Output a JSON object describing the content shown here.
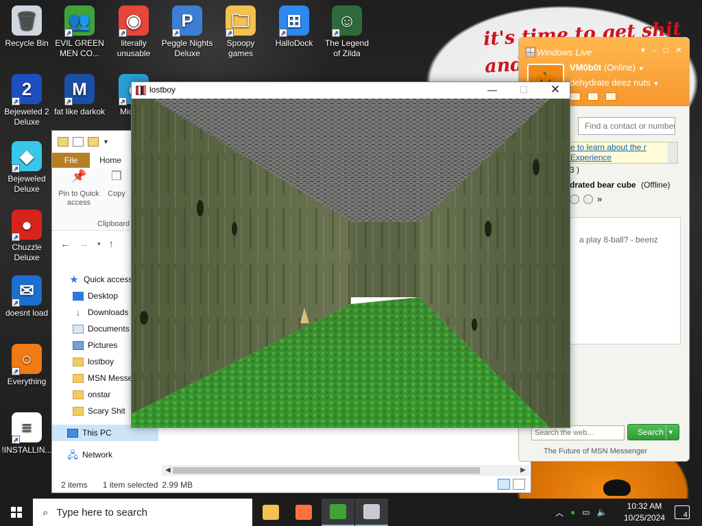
{
  "desktop": {
    "wallpaper_text": "it's time to get shit and",
    "icons": [
      {
        "label": "Recycle Bin",
        "icon": "recycle-bin-icon",
        "color": "#cfd6de"
      },
      {
        "label": "EVIL GREEN MEN CO...",
        "icon": "msn-buddies-icon",
        "color": "#3fa33a"
      },
      {
        "label": "literally unusable",
        "icon": "chrome-icon",
        "color": "#e8453c"
      },
      {
        "label": "Peggle Nights Deluxe",
        "icon": "peggle-icon",
        "color": "#3c7fd8"
      },
      {
        "label": "Spoopy games",
        "icon": "folder-icon",
        "color": "#f2c14e"
      },
      {
        "label": "HalloDock",
        "icon": "windows-logo-icon",
        "color": "#2d89ef"
      },
      {
        "label": "The Legend of Zilda",
        "icon": "zilda-icon",
        "color": "#2f6b3a"
      },
      {
        "label": "Bejeweled 2 Deluxe",
        "icon": "bejeweled-2-icon",
        "color": "#1f4fbf"
      },
      {
        "label": "fat like darkok",
        "icon": "mpl-icon",
        "color": "#1a4fa8"
      },
      {
        "label": "Micr Ec",
        "icon": "edge-icon",
        "color": "#2aa0d8"
      },
      {
        "label": "Bejeweled Deluxe",
        "icon": "diamond-icon",
        "color": "#38c7e8"
      },
      {
        "label": "Chuzzle Deluxe",
        "icon": "chuzzle-icon",
        "color": "#d8231c"
      },
      {
        "label": "doesnt load",
        "icon": "thunderbird-icon",
        "color": "#1b6fd0"
      },
      {
        "label": "Everything",
        "icon": "magnifier-icon",
        "color": "#f07a15"
      },
      {
        "label": "!INSTALLIN...",
        "icon": "text-file-icon",
        "color": "#ffffff"
      }
    ]
  },
  "explorer": {
    "tabs": [
      "File",
      "Home"
    ],
    "ribbon": {
      "pin": "Pin to Quick access",
      "copy": "Copy",
      "group": "Clipboard"
    },
    "tree": [
      {
        "label": "Quick access",
        "icon": "star-icon",
        "kind": "star"
      },
      {
        "label": "Desktop",
        "icon": "desktop-icon",
        "kind": "blue"
      },
      {
        "label": "Downloads",
        "icon": "downloads-icon",
        "kind": "down"
      },
      {
        "label": "Documents",
        "icon": "documents-icon",
        "kind": "doc"
      },
      {
        "label": "Pictures",
        "icon": "pictures-icon",
        "kind": "pic"
      },
      {
        "label": "lostboy",
        "icon": "folder-icon",
        "kind": "folder"
      },
      {
        "label": "MSN Messenger",
        "icon": "folder-icon",
        "kind": "folder"
      },
      {
        "label": "onstar",
        "icon": "folder-icon",
        "kind": "folder"
      },
      {
        "label": "Scary Shit",
        "icon": "folder-icon",
        "kind": "folder"
      }
    ],
    "this_pc": "This PC",
    "network": "Network",
    "status": {
      "items": "2 items",
      "selected": "1 item selected",
      "size": "2.99 MB"
    }
  },
  "messenger": {
    "title": "Windows Live",
    "username": "VM0b0t",
    "status": "(Online)",
    "personal_message": "dehydrate deez nuts",
    "contact_search_placeholder": "Find a contact or number",
    "promo": "e to learn about the r Experience",
    "group_count": "3 )",
    "contact_name": "drated bear cube",
    "contact_status": "(Offline)",
    "invite_text": "a play 8-ball? - beenz",
    "web_search_placeholder": "Search the web...",
    "search_button": "Search",
    "footer": "The Future of MSN Messenger",
    "more_glyph": "»"
  },
  "game": {
    "title": "lostboy",
    "minimize": "—",
    "maximize": "☐",
    "close": "✕"
  },
  "taskbar": {
    "search_placeholder": "Type here to search",
    "apps": [
      {
        "name": "file-explorer-taskbar-icon",
        "color": "#f2c14e",
        "active": false
      },
      {
        "name": "firefox-taskbar-icon",
        "color": "#ff7139",
        "active": false
      },
      {
        "name": "msn-messenger-taskbar-icon",
        "color": "#3fa33a",
        "active": true
      },
      {
        "name": "lostboy-taskbar-icon",
        "color": "#c9c9d6",
        "active": true
      }
    ],
    "time": "10:32 AM",
    "date": "10/25/2024",
    "notifications": "4"
  }
}
